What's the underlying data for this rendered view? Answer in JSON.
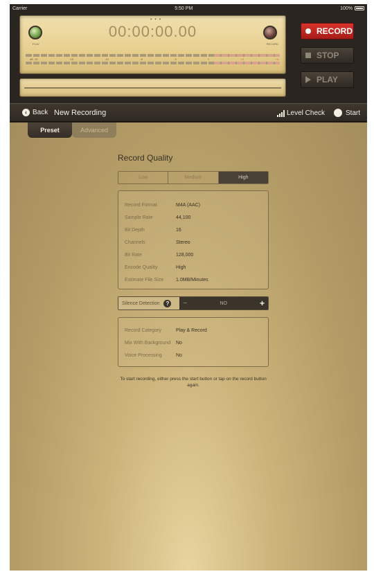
{
  "status_bar": {
    "carrier": "Carrier",
    "time": "5:50 PM",
    "battery": "100%"
  },
  "meter": {
    "timer": "00:00:00.00",
    "play_label": "PLAY",
    "record_label": "RECORD",
    "scale": [
      "dB -20",
      "-15",
      "-10",
      "-6",
      "-3",
      "0",
      "+2",
      "+3"
    ]
  },
  "transport": {
    "record": "RECORD",
    "stop": "STOP",
    "play": "PLAY"
  },
  "nav": {
    "back": "Back",
    "title": "New Recording",
    "level_check": "Level Check",
    "start": "Start"
  },
  "tabs": [
    {
      "label": "Preset"
    },
    {
      "label": "Advanced"
    }
  ],
  "record_quality": {
    "title": "Record Quality",
    "options": [
      "Low",
      "Medium",
      "High"
    ],
    "selected": "High"
  },
  "details": [
    {
      "label": "Record Format",
      "value": "M4A (AAC)"
    },
    {
      "label": "Sample Rate",
      "value": "44,100"
    },
    {
      "label": "Bit Depth",
      "value": "16"
    },
    {
      "label": "Channels",
      "value": "Stereo"
    },
    {
      "label": "Bit Rate",
      "value": "128,000"
    },
    {
      "label": "Encode Quality",
      "value": "High"
    },
    {
      "label": "Estimate File Size",
      "value": "1.0MB/Minutes"
    }
  ],
  "silence_detection": {
    "label": "Silence Detection",
    "value": "NO",
    "minus": "−",
    "plus": "+"
  },
  "category": [
    {
      "label": "Record Category",
      "value": "Play & Record"
    },
    {
      "label": "Mix With Background",
      "value": "No"
    },
    {
      "label": "Voice Processing",
      "value": "No"
    }
  ],
  "hint": "To start recording, either press the start button or tap on the record button again."
}
